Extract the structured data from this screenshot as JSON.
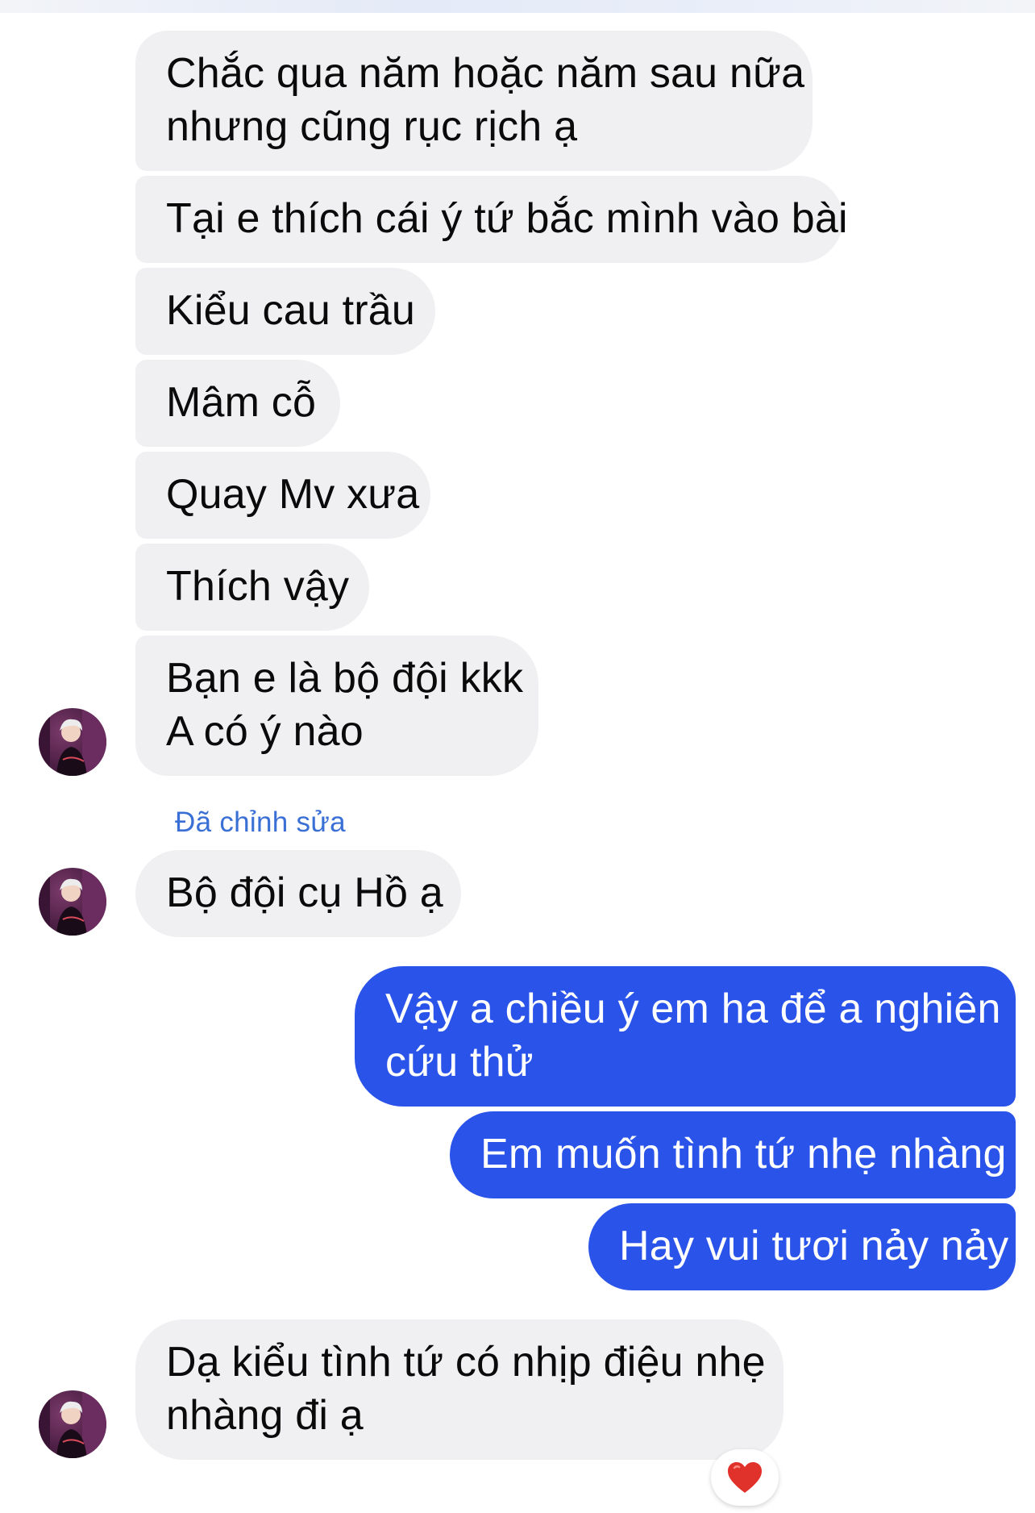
{
  "conversation": {
    "incoming_messages": [
      {
        "lines": [
          "Chắc qua năm hoặc năm sau nữa",
          "nhưng cũng rục rịch ạ"
        ]
      },
      {
        "lines": [
          "Tại e thích cái ý tứ bắc mình vào bài"
        ]
      },
      {
        "lines": [
          "Kiểu cau trầu"
        ]
      },
      {
        "lines": [
          "Mâm cỗ"
        ]
      },
      {
        "lines": [
          "Quay Mv xưa"
        ]
      },
      {
        "lines": [
          "Thích vậy"
        ]
      },
      {
        "lines": [
          "Bạn e là bộ đội kkk",
          "A có ý nào"
        ]
      }
    ],
    "edited_label": "Đã chỉnh sửa",
    "edited_message": {
      "lines": [
        "Bộ đội cụ Hồ ạ"
      ]
    },
    "outgoing_messages": [
      {
        "lines": [
          "Vậy a chiều ý em ha để a nghiên",
          "cứu thử"
        ]
      },
      {
        "lines": [
          "Em muốn tình tứ nhẹ nhàng"
        ]
      },
      {
        "lines": [
          "Hay vui tươi nảy nảy"
        ]
      }
    ],
    "last_incoming_message": {
      "lines": [
        "Dạ kiểu tình tứ có nhịp điệu nhẹ",
        "nhàng đi ạ"
      ]
    },
    "reaction": {
      "icon": "heart-icon",
      "color": "#e0322b"
    }
  },
  "colors": {
    "incoming_bubble": "#f0f0f2",
    "outgoing_bubble": "#2a53ea",
    "edited_label": "#3a6fd6"
  }
}
